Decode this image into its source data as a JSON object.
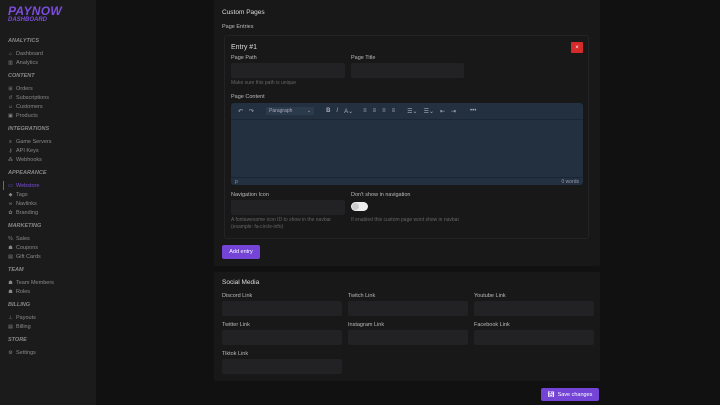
{
  "brand": {
    "title": "PAYNOW",
    "subtitle": "DASHBOARD"
  },
  "sidebar": [
    {
      "header": "ANALYTICS",
      "items": [
        {
          "label": "Dashboard",
          "icon": "⌂"
        },
        {
          "label": "Analytics",
          "icon": "▥"
        }
      ]
    },
    {
      "header": "CONTENT",
      "items": [
        {
          "label": "Orders",
          "icon": "⊞"
        },
        {
          "label": "Subscriptions",
          "icon": "↺"
        },
        {
          "label": "Customers",
          "icon": "☺"
        },
        {
          "label": "Products",
          "icon": "▣"
        }
      ]
    },
    {
      "header": "INTEGRATIONS",
      "items": [
        {
          "label": "Game Servers",
          "icon": "≡"
        },
        {
          "label": "API Keys",
          "icon": "⚷"
        },
        {
          "label": "Webhooks",
          "icon": "⁂"
        }
      ]
    },
    {
      "header": "APPEARANCE",
      "items": [
        {
          "label": "Webstore",
          "icon": "▭",
          "active": true
        },
        {
          "label": "Tags",
          "icon": "◆"
        },
        {
          "label": "Navlinks",
          "icon": "∞"
        },
        {
          "label": "Branding",
          "icon": "✿"
        }
      ]
    },
    {
      "header": "MARKETING",
      "items": [
        {
          "label": "Sales",
          "icon": "%"
        },
        {
          "label": "Coupons",
          "icon": "☗"
        },
        {
          "label": "Gift Cards",
          "icon": "▤"
        }
      ]
    },
    {
      "header": "TEAM",
      "items": [
        {
          "label": "Team Members",
          "icon": "☗"
        },
        {
          "label": "Roles",
          "icon": "☗"
        }
      ]
    },
    {
      "header": "BILLING",
      "items": [
        {
          "label": "Payouts",
          "icon": "⊥"
        },
        {
          "label": "Billing",
          "icon": "▤"
        }
      ]
    },
    {
      "header": "STORE",
      "items": [
        {
          "label": "Settings",
          "icon": "⚙"
        }
      ]
    }
  ],
  "custom_pages": {
    "title": "Custom Pages",
    "entries_label": "Page Entries",
    "entry": {
      "title": "Entry #1",
      "delete": "×",
      "path_label": "Page Path",
      "path_value": "",
      "path_hint": "Make sure this path is unique",
      "title_label": "Page Title",
      "title_value": "",
      "content_label": "Page Content",
      "editor": {
        "format": "Paragraph",
        "status_left": "p",
        "status_right": "0 words"
      },
      "nav_icon_label": "Navigation Icon",
      "nav_icon_value": "",
      "nav_icon_hint": "A fontawesome icon ID to show in the navbar (example: fa-circle-info)",
      "hide_label": "Don't show in navigation",
      "hide_value": false,
      "hide_hint": "If enabled this custom page wont show in navbar"
    },
    "add_entry": "Add entry"
  },
  "social": {
    "title": "Social Media",
    "fields": [
      {
        "label": "Discord Link",
        "value": ""
      },
      {
        "label": "Twitch Link",
        "value": ""
      },
      {
        "label": "Youtube Link",
        "value": ""
      },
      {
        "label": "Twitter Link",
        "value": ""
      },
      {
        "label": "Instagram Link",
        "value": ""
      },
      {
        "label": "Facebook Link",
        "value": ""
      },
      {
        "label": "Tiktok Link",
        "value": ""
      }
    ]
  },
  "save": "Save changes"
}
